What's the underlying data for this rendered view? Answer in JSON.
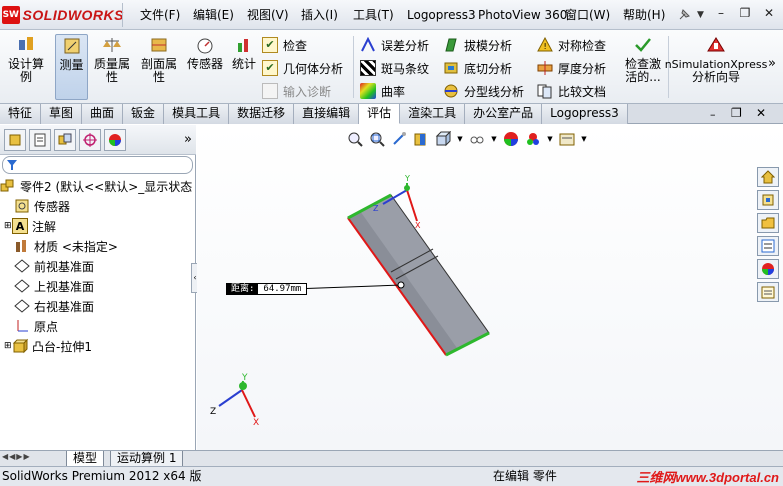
{
  "app": {
    "logo_text": "SOLIDWORKS",
    "logo_mark": "SW"
  },
  "menu": [
    "文件(F)",
    "编辑(E)",
    "视图(V)",
    "插入(I)",
    "工具(T)",
    "Logopress3",
    "PhotoView 360",
    "窗口(W)",
    "帮助(H)"
  ],
  "window_controls": {
    "minimize": "–",
    "restore": "❐",
    "close": "✕"
  },
  "commands": {
    "design_study": "设计算例",
    "measure": "测量",
    "mass_props": "质量属性",
    "section_props": "剖面属性",
    "sensor": "传感器",
    "statistics": "统计",
    "check": "检查",
    "geometry_analysis": "几何体分析",
    "import_diag": "输入诊断",
    "deviation": "误差分析",
    "zebra": "斑马条纹",
    "curvature": "曲率",
    "draft": "拔模分析",
    "undercut": "底切分析",
    "parting_line": "分型线分析",
    "symmetry": "对称检查",
    "thickness": "厚度分析",
    "compare": "比较文档",
    "check_active": "检查激活的...",
    "simxpress": "nSimulationXpress",
    "simxpress2": "分析向导"
  },
  "tabs": [
    "特征",
    "草图",
    "曲面",
    "钣金",
    "模具工具",
    "数据迁移",
    "直接编辑",
    "评估",
    "渲染工具",
    "办公室产品",
    "Logopress3"
  ],
  "selected_tab": "评估",
  "tree": {
    "root": "零件2 (默认<<默认>_显示状态",
    "items": [
      "传感器",
      "注解",
      "材质 <未指定>",
      "前视基准面",
      "上视基准面",
      "右视基准面",
      "原点",
      "凸台-拉伸1"
    ]
  },
  "dimension": {
    "label": "距离:",
    "value": "64.97mm"
  },
  "bottom_tabs": [
    "模型",
    "运动算例 1"
  ],
  "status": {
    "left": "SolidWorks Premium 2012 x64 版",
    "right": "在编辑 零件"
  },
  "watermark": "三维网www.3dportal.cn",
  "colors": {
    "accent": "#c91515",
    "selection": "#e01818",
    "green": "#2eb82e",
    "blue": "#2a3fd0"
  }
}
